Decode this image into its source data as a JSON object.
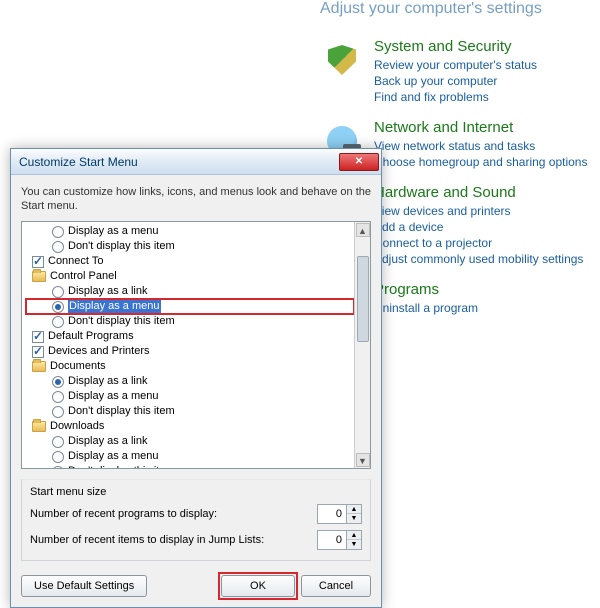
{
  "controlPanel": {
    "heading": "Adjust your computer's settings",
    "categories": [
      {
        "icon": "shield",
        "title": "System and Security",
        "links": [
          "Review your computer's status",
          "Back up your computer",
          "Find and fix problems"
        ]
      },
      {
        "icon": "globe",
        "title": "Network and Internet",
        "links": [
          "View network status and tasks",
          "Choose homegroup and sharing options"
        ]
      },
      {
        "icon": "",
        "title": "Hardware and Sound",
        "links": [
          "View devices and printers",
          "Add a device",
          "Connect to a projector",
          "Adjust commonly used mobility settings"
        ],
        "partial": true
      },
      {
        "icon": "",
        "title": "Programs",
        "links": [
          "Uninstall a program"
        ],
        "partial": true
      }
    ]
  },
  "dialog": {
    "title": "Customize Start Menu",
    "instruction": "You can customize how links, icons, and menus look and behave on the Start menu.",
    "tree": [
      {
        "type": "radio",
        "level": 2,
        "selected": false,
        "label": "Display as a menu"
      },
      {
        "type": "radio",
        "level": 2,
        "selected": false,
        "label": "Don't display this item"
      },
      {
        "type": "check",
        "level": 1,
        "selected": true,
        "label": "Connect To"
      },
      {
        "type": "folder",
        "level": 1,
        "label": "Control Panel"
      },
      {
        "type": "radio",
        "level": 2,
        "selected": false,
        "label": "Display as a link"
      },
      {
        "type": "radio",
        "level": 2,
        "selected": true,
        "label": "Display as a menu",
        "highlighted": true
      },
      {
        "type": "radio",
        "level": 2,
        "selected": false,
        "label": "Don't display this item"
      },
      {
        "type": "check",
        "level": 1,
        "selected": true,
        "label": "Default Programs"
      },
      {
        "type": "check",
        "level": 1,
        "selected": true,
        "label": "Devices and Printers"
      },
      {
        "type": "folder",
        "level": 1,
        "label": "Documents"
      },
      {
        "type": "radio",
        "level": 2,
        "selected": true,
        "label": "Display as a link"
      },
      {
        "type": "radio",
        "level": 2,
        "selected": false,
        "label": "Display as a menu"
      },
      {
        "type": "radio",
        "level": 2,
        "selected": false,
        "label": "Don't display this item"
      },
      {
        "type": "folder",
        "level": 1,
        "label": "Downloads"
      },
      {
        "type": "radio",
        "level": 2,
        "selected": false,
        "label": "Display as a link"
      },
      {
        "type": "radio",
        "level": 2,
        "selected": false,
        "label": "Display as a menu"
      },
      {
        "type": "radio",
        "level": 2,
        "selected": true,
        "label": "Don't display this item"
      }
    ],
    "sizeSection": {
      "heading": "Start menu size",
      "row1_label": "Number of recent programs to display:",
      "row1_value": "0",
      "row2_label": "Number of recent items to display in Jump Lists:",
      "row2_value": "0"
    },
    "buttons": {
      "defaults": "Use Default Settings",
      "ok": "OK",
      "cancel": "Cancel"
    }
  }
}
